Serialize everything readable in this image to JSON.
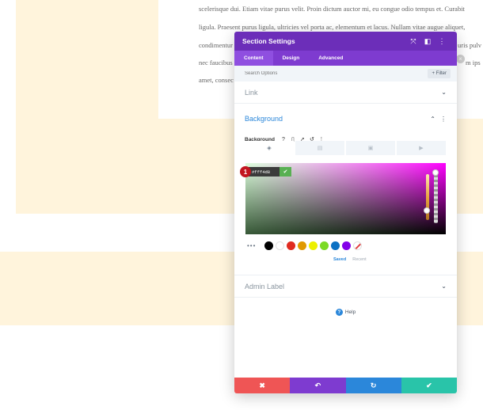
{
  "background_page": {
    "lines": [
      "scelerisque dui. Etiam vitae purus velit. Proin dictum auctor mi, eu congue odio tempus et. Curabit",
      "ligula. Praesent purus ligula, ultricies vel porta ac, elementum et lacus. Nullam vitae augue aliquet,",
      "condimentur",
      "nec faucibus",
      "amet, consec"
    ],
    "right_fragments": [
      "uris pulv",
      "m ips"
    ]
  },
  "modal": {
    "title": "Section Settings",
    "tabs": [
      {
        "label": "Content",
        "active": true
      },
      {
        "label": "Design",
        "active": false
      },
      {
        "label": "Advanced",
        "active": false
      }
    ],
    "search_placeholder": "Search Options",
    "filter_label": "+ Filter",
    "sections": {
      "link": "Link",
      "background": "Background",
      "admin_label": "Admin Label"
    },
    "background_field_label": "Background",
    "color_picker": {
      "hex_value": "#fff4d8",
      "step_number": "1",
      "swatches": [
        "#000000",
        "#ffffff",
        "#e02b20",
        "#e09900",
        "#edf000",
        "#7cda24",
        "#0c71c3",
        "#8300e9"
      ],
      "more_label": "•••",
      "saved_label": "Saved",
      "recent_label": "Recent"
    },
    "help_label": "Help",
    "footer_buttons": [
      {
        "name": "cancel",
        "glyph": "✖",
        "color": "#ef5555"
      },
      {
        "name": "undo",
        "glyph": "↶",
        "color": "#7e3bd0"
      },
      {
        "name": "redo",
        "glyph": "↻",
        "color": "#2b87da"
      },
      {
        "name": "save",
        "glyph": "✔",
        "color": "#29c4a9"
      }
    ]
  }
}
